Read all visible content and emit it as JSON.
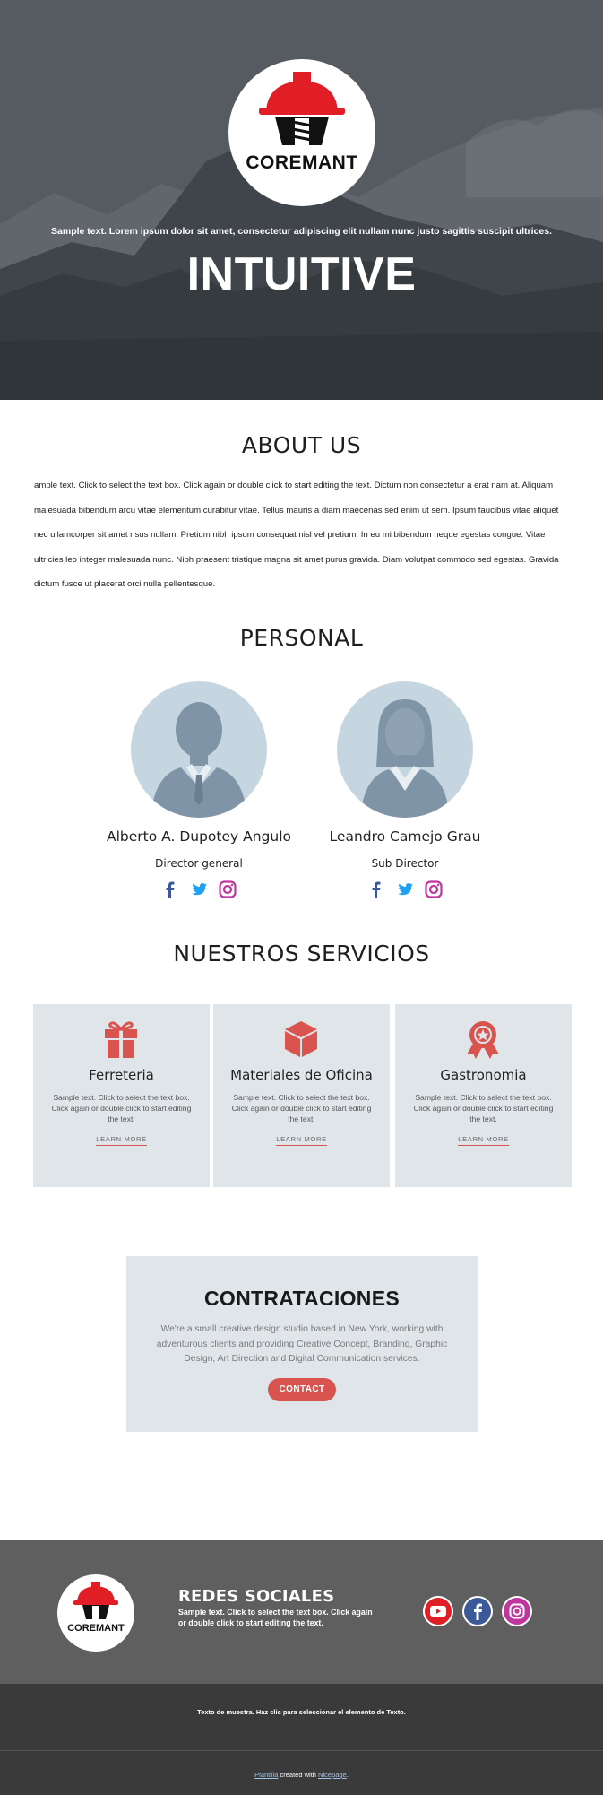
{
  "hero": {
    "logo_text": "COREMANT",
    "sample_text": "Sample text. Lorem ipsum dolor sit amet, consectetur adipiscing elit nullam nunc justo sagittis suscipit ultrices.",
    "title": "INTUITIVE"
  },
  "about": {
    "title": "ABOUT US",
    "text": "ample text. Click to select the text box. Click again or double click to start editing the text. Dictum non consectetur a erat nam at. Aliquam malesuada bibendum arcu vitae elementum curabitur vitae. Tellus mauris a diam maecenas sed enim ut sem. Ipsum faucibus vitae aliquet nec ullamcorper sit amet risus nullam. Pretium nibh ipsum consequat nisl vel pretium. In eu mi bibendum neque egestas congue. Vitae ultricies leo integer malesuada nunc. Nibh praesent tristique magna sit amet purus gravida. Diam volutpat commodo sed egestas. Gravida dictum fusce ut placerat orci nulla pellentesque."
  },
  "personal": {
    "title": "PERSONAL",
    "people": [
      {
        "name": "Alberto A. Dupotey Angulo",
        "role": "Director general",
        "icons": [
          "facebook-icon",
          "twitter-icon",
          "instagram-icon"
        ]
      },
      {
        "name": "Leandro Camejo Grau",
        "role": "Sub Director",
        "icons": [
          "facebook-icon",
          "twitter-icon",
          "instagram-icon"
        ]
      }
    ]
  },
  "services": {
    "title": "NUESTROS SERVICIOS",
    "items": [
      {
        "title": "Ferreteria",
        "text": "Sample text. Click to select the text box. Click again or double click to start editing the text.",
        "link": "LEARN MORE",
        "icon": "gift-icon"
      },
      {
        "title": "Materiales de Oficina",
        "text": "Sample text. Click to select the text box. Click again or double click to start editing the text.",
        "link": "LEARN MORE",
        "icon": "cube-icon"
      },
      {
        "title": "Gastronomia",
        "text": "Sample text. Click to select the text box. Click again or double click to start editing the text.",
        "link": "LEARN MORE",
        "icon": "award-icon"
      }
    ]
  },
  "contract": {
    "title": "CONTRATACIONES",
    "text": "We're a small creative design studio based in New York, working with adventurous clients and providing Creative Concept, Branding, Graphic Design, Art Direction and Digital Communication services.",
    "button": "CONTACT"
  },
  "footer": {
    "logo_text": "COREMANT",
    "heading": "REDES SOCIALES",
    "sample": "Sample text. Click to select the text box. Click again or double click to start editing the text.",
    "socials": [
      "youtube-icon",
      "facebook-icon",
      "instagram-icon"
    ],
    "note": "Texto de muestra. Haz clic para seleccionar el elemento de Texto.",
    "credit_link1": "Plantilla",
    "credit_mid": " created with ",
    "credit_link2": "Nicepage",
    "credit_end": "."
  },
  "colors": {
    "accent": "#d9534f",
    "hero_bg": "#4c5258",
    "card_bg": "#e0e5ea",
    "footer_top": "#5f5f5f",
    "footer_bottom": "#3a3a3a"
  }
}
